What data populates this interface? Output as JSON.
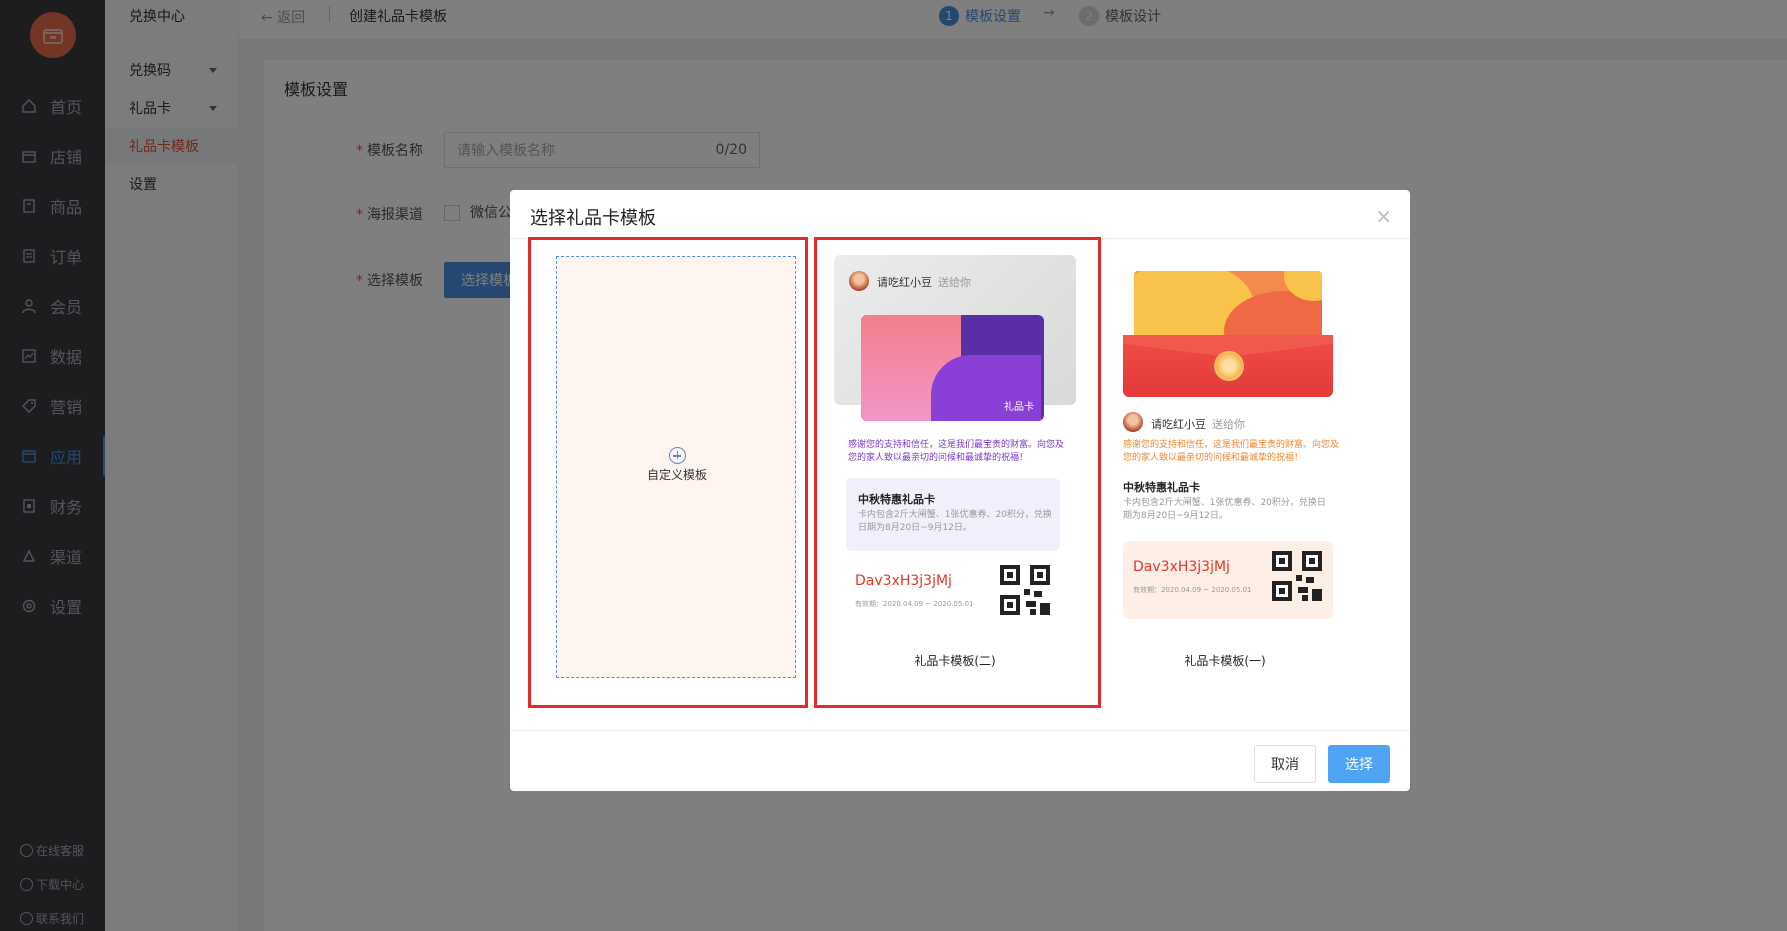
{
  "sidebar": {
    "items": [
      {
        "label": "首页",
        "icon": "home-icon"
      },
      {
        "label": "店铺",
        "icon": "store-icon"
      },
      {
        "label": "商品",
        "icon": "goods-icon"
      },
      {
        "label": "订单",
        "icon": "order-icon"
      },
      {
        "label": "会员",
        "icon": "member-icon"
      },
      {
        "label": "数据",
        "icon": "chart-icon"
      },
      {
        "label": "营销",
        "icon": "tag-icon"
      },
      {
        "label": "应用",
        "icon": "app-icon"
      },
      {
        "label": "财务",
        "icon": "finance-icon"
      },
      {
        "label": "渠道",
        "icon": "channel-icon"
      },
      {
        "label": "设置",
        "icon": "settings-icon"
      }
    ],
    "footer": [
      "在线客服",
      "下载中心",
      "联系我们"
    ]
  },
  "subnav": {
    "title": "兑换中心",
    "items": [
      "兑换码",
      "礼品卡",
      "礼品卡模板",
      "设置"
    ]
  },
  "header": {
    "back": "← 返回",
    "title": "创建礼品卡模板",
    "step1_num": "1",
    "step1": "模板设置",
    "step2_num": "2",
    "step2": "模板设计"
  },
  "form": {
    "section": "模板设置",
    "name_label": "模板名称",
    "name_placeholder": "请输入模板名称",
    "name_count": "0/20",
    "channel_label": "海报渠道",
    "channel_option": "微信公",
    "template_label": "选择模板",
    "template_button": "选择模板"
  },
  "modal": {
    "title": "选择礼品卡模板",
    "close": "×",
    "custom_label": "自定义模板",
    "cancel": "取消",
    "choose": "选择",
    "templates": [
      {
        "caption": "礼品卡模板(二)",
        "sender": "请吃红小豆",
        "sends": "送给你",
        "card_label": "礼品卡",
        "message": "感谢您的支持和信任，这是我们最宝贵的财富。向您及您的家人致以最亲切的问候和最诚挚的祝福！",
        "box_title": "中秋特惠礼品卡",
        "box_desc": "卡内包含2斤大闸蟹、1张优惠券、20积分，兑换日期为8月20日~9月12日。",
        "code": "Dav3xH3j3jMj",
        "valid": "有效期：2020.04.09 ~ 2020.05.01"
      },
      {
        "caption": "礼品卡模板(一)",
        "sender": "请吃红小豆",
        "sends": "送给你",
        "message": "感谢您的支持和信任，这是我们最宝贵的财富。向您及您的家人致以最亲切的问候和最诚挚的祝福！",
        "box_title": "中秋特惠礼品卡",
        "box_desc": "卡内包含2斤大闸蟹、1张优惠券、20积分，兑换日期为8月20日~9月12日。",
        "code": "Dav3xH3j3jMj",
        "valid": "有效期：2020.04.09 ~ 2020.05.01"
      }
    ]
  },
  "colors": {
    "accent": "#4a90e2",
    "active_subnav": "#e5503a",
    "highlight_frame": "#e52a2a"
  }
}
